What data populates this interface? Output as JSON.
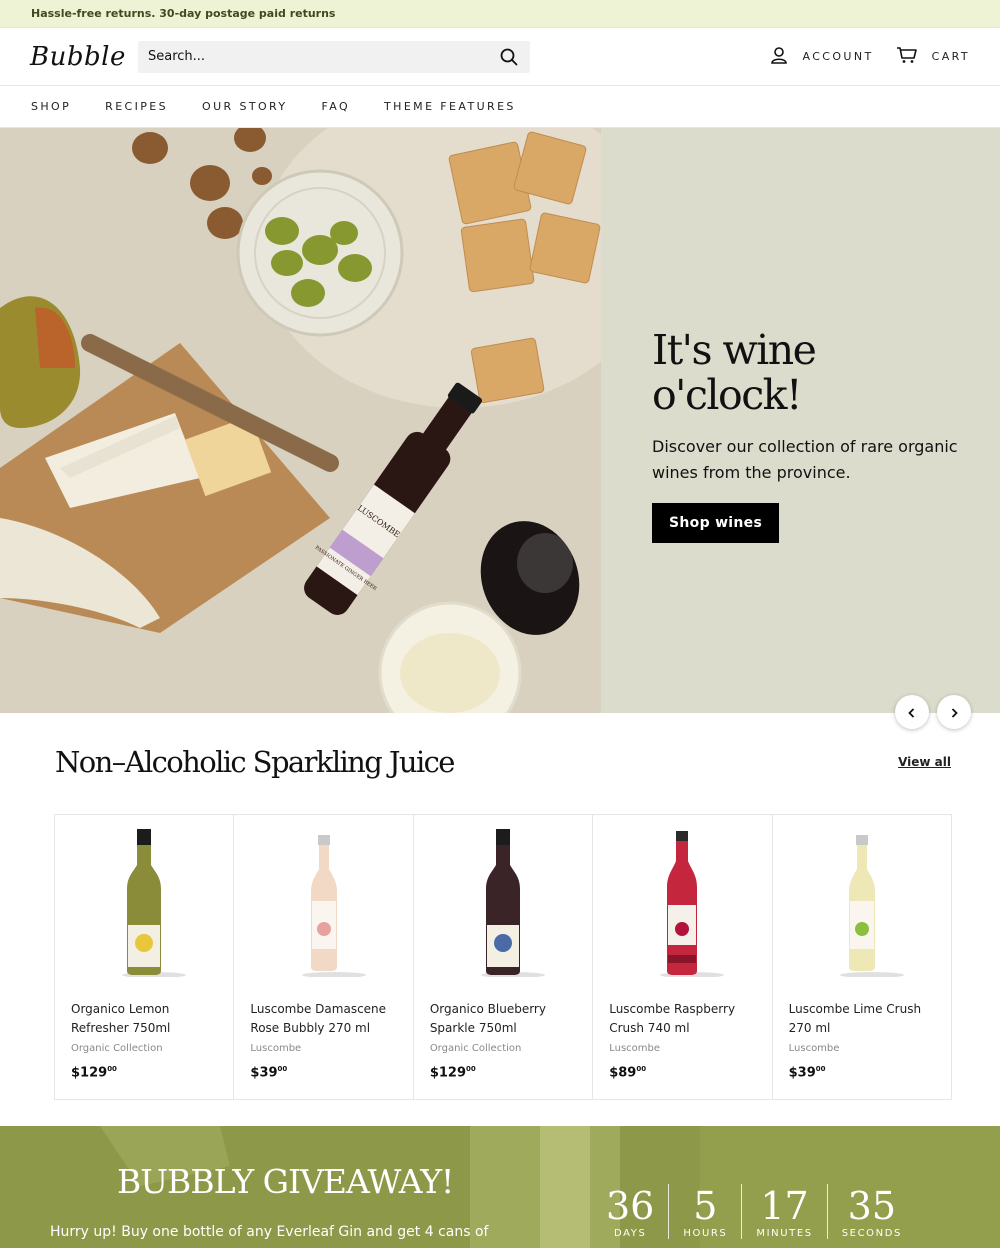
{
  "announcement": {
    "text": "Hassle-free returns. 30-day postage paid returns"
  },
  "header": {
    "logo": "Bubble",
    "search_placeholder": "Search...",
    "account_label": "ACCOUNT",
    "cart_label": "CART"
  },
  "nav": {
    "items": [
      "SHOP",
      "RECIPES",
      "OUR STORY",
      "FAQ",
      "THEME FEATURES"
    ]
  },
  "hero": {
    "title": "It's wine o'clock!",
    "subtitle": "Discover our collection of rare organic wines from the province.",
    "button": "Shop wines",
    "bottle_label_1": "LUSCOMBE",
    "bottle_label_2": "PASSIONATE GINGER BEER"
  },
  "collection": {
    "title": "Non–Alcoholic Sparkling Juice",
    "view_all": "View all",
    "products": [
      {
        "title": "Organico Lemon Refresher 750ml",
        "vendor": "Organic Collection",
        "price": "$129",
        "cents": "00",
        "bottle": "#8a8c3a",
        "fruit": "#e8c83a",
        "shape": "wine"
      },
      {
        "title": "Luscombe Damascene Rose Bubbly 270 ml",
        "vendor": "Luscombe",
        "price": "$39",
        "cents": "00",
        "bottle": "#f1d9c6",
        "fruit": "#e7a2a0",
        "shape": "small"
      },
      {
        "title": "Organico Blueberry Sparkle 750ml",
        "vendor": "Organic Collection",
        "price": "$129",
        "cents": "00",
        "bottle": "#3b2427",
        "fruit": "#4b6aa8",
        "shape": "wine"
      },
      {
        "title": "Luscombe Raspberry Crush 740 ml",
        "vendor": "Luscombe",
        "price": "$89",
        "cents": "00",
        "bottle": "#c4263d",
        "fruit": "#b3133a",
        "shape": "tall"
      },
      {
        "title": "Luscombe Lime Crush 270 ml",
        "vendor": "Luscombe",
        "price": "$39",
        "cents": "00",
        "bottle": "#ede8b6",
        "fruit": "#8bbf3d",
        "shape": "small"
      }
    ]
  },
  "giveaway": {
    "title": "BUBBLY GIVEAWAY!",
    "subtitle": "Hurry up! Buy one bottle of any Everleaf Gin and get 4 cans of",
    "timer": [
      {
        "value": "36",
        "label": "DAYS"
      },
      {
        "value": "5",
        "label": "HOURS"
      },
      {
        "value": "17",
        "label": "MINUTES"
      },
      {
        "value": "35",
        "label": "SECONDS"
      }
    ]
  },
  "colors": {
    "announce_bg": "#eef3d6",
    "hero_bg": "#dcdccd",
    "giveaway_bg": "#8d9948",
    "button_bg": "#000000"
  }
}
